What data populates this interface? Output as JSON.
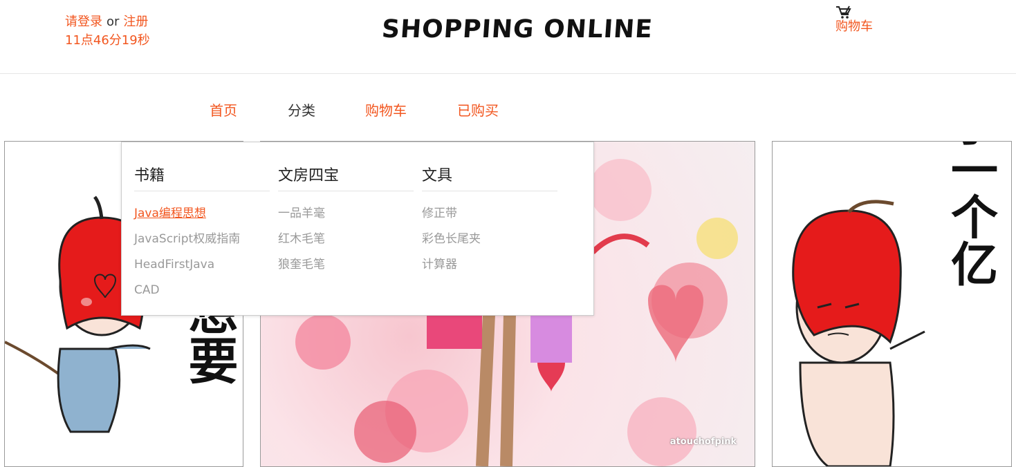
{
  "header": {
    "login_label": "请登录",
    "or_label": "or",
    "register_label": "注册",
    "clock": "11点46分19秒",
    "title": "SHOPPING ONLINE",
    "cart_label": "购物车",
    "cart_icon": "cart-icon"
  },
  "nav": {
    "items": [
      {
        "label": "首页"
      },
      {
        "label": "分类"
      },
      {
        "label": "购物车"
      },
      {
        "label": "已购买"
      }
    ]
  },
  "dropdown": {
    "columns": [
      {
        "title": "书籍",
        "items": [
          "Java编程思想",
          "JavaScript权威指南",
          "HeadFirstJava",
          "CAD"
        ]
      },
      {
        "title": "文房四宝",
        "items": [
          "一品羊毫",
          "红木毛笔",
          "狼奎毛笔"
        ]
      },
      {
        "title": "文具",
        "items": [
          "修正带",
          "彩色长尾夹",
          "计算器"
        ]
      }
    ]
  },
  "banner": {
    "left_text": "想要",
    "right_text": "花了一个亿",
    "watermark": "atouchofpink"
  },
  "colors": {
    "accent": "#f2561f",
    "text": "#333333",
    "muted": "#999999"
  }
}
